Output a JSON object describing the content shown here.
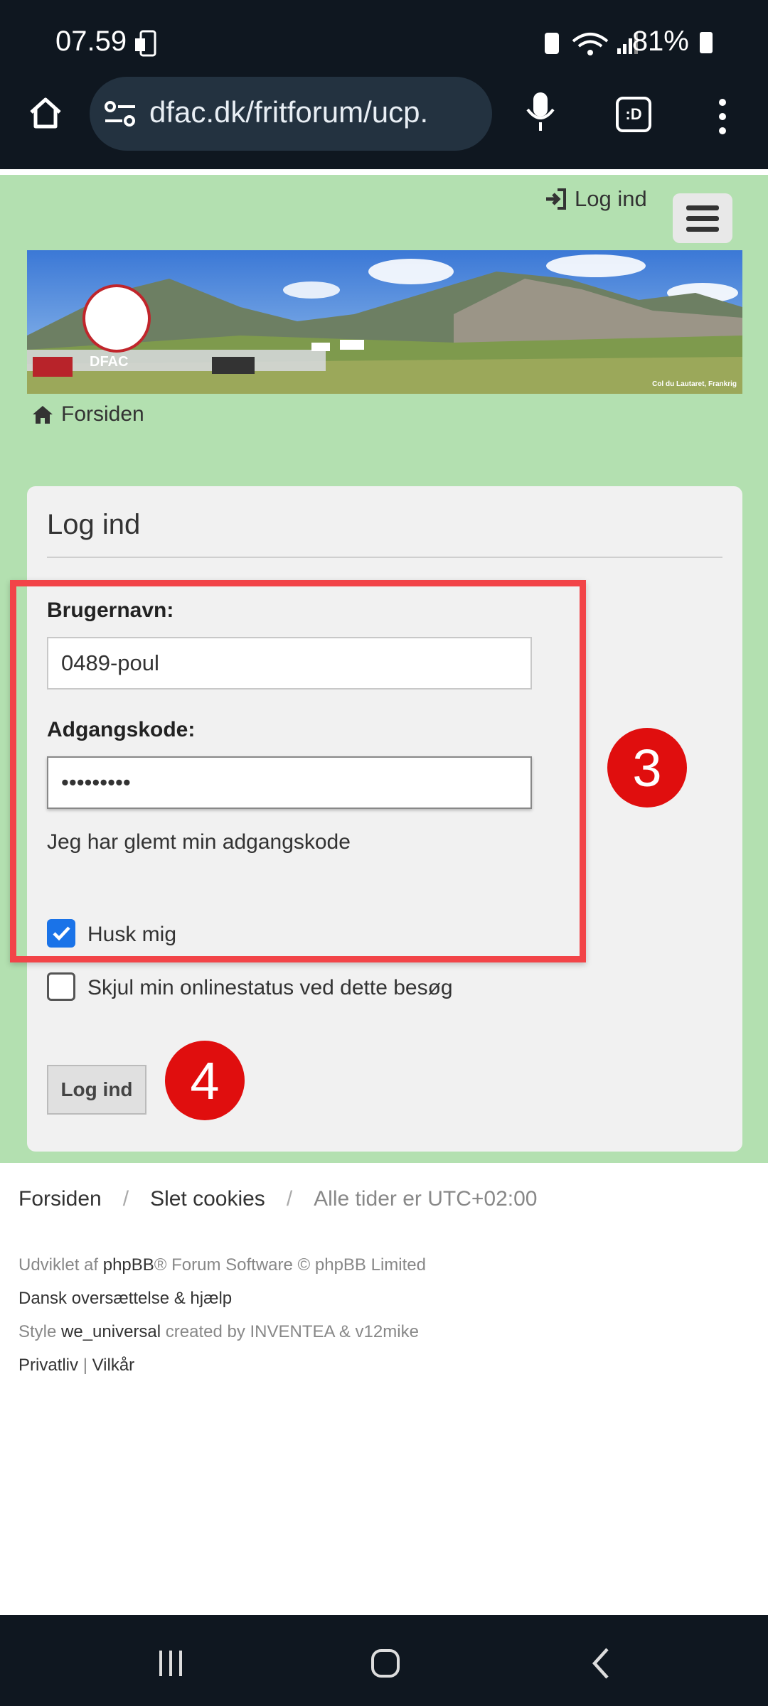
{
  "status_bar": {
    "time": "07.59",
    "battery": "81%"
  },
  "browser": {
    "url": "dfac.dk/fritforum/ucp."
  },
  "header": {
    "login_link": "Log ind",
    "banner_logo_text": "DFAC",
    "banner_caption": "Col du Lautaret, Frankrig",
    "breadcrumb": "Forsiden"
  },
  "form": {
    "title": "Log ind",
    "username_label": "Brugernavn:",
    "username_value": "0489-poul",
    "password_label": "Adgangskode:",
    "password_value": "•••••••••",
    "forgot_link": "Jeg har glemt min adgangskode",
    "remember_label": "Husk mig",
    "remember_checked": true,
    "hide_status_label": "Skjul min onlinestatus ved dette besøg",
    "hide_status_checked": false,
    "submit_label": "Log ind"
  },
  "annotations": {
    "step_a": "3",
    "step_b": "4",
    "highlight_color": "#f24448",
    "badge_color": "#e00e0e"
  },
  "footer": {
    "nav": [
      "Forsiden",
      "Slet cookies"
    ],
    "timezone": "Alle tider er UTC+02:00",
    "credits": {
      "line1_prefix": "Udviklet af ",
      "line1_link": "phpBB",
      "line1_suffix": "® Forum Software © phpBB Limited",
      "line2": "Dansk oversættelse & hjælp",
      "line3_prefix": "Style ",
      "line3_link": "we_universal",
      "line3_suffix": " created by INVENTEA & v12mike",
      "privacy": "Privatliv",
      "sep": "|",
      "terms": "Vilkår"
    }
  },
  "colors": {
    "page_bg": "#b3e0b0",
    "panel_bg": "#f1f1f1",
    "chrome_bg": "#0f1720",
    "checkbox_blue": "#1a73e8"
  }
}
